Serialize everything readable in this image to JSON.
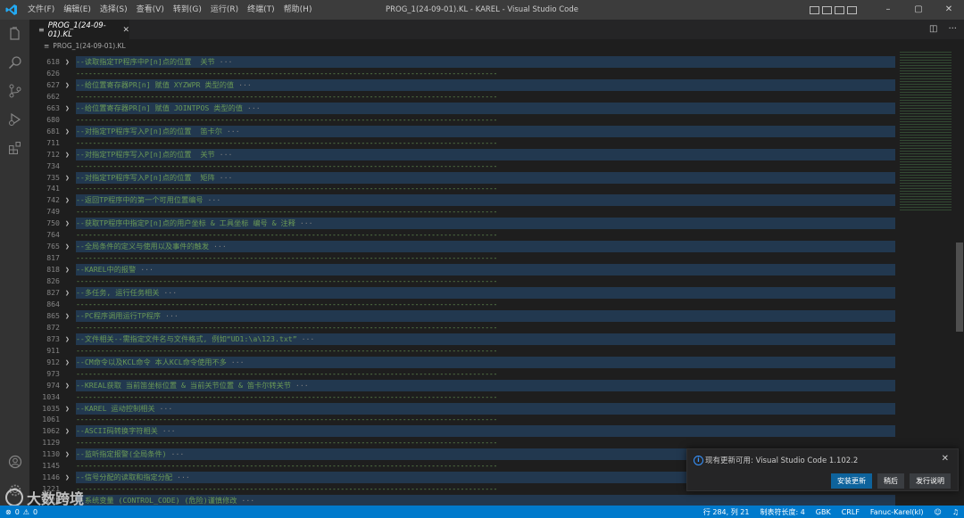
{
  "titlebar": {
    "menu": [
      "文件(F)",
      "编辑(E)",
      "选择(S)",
      "查看(V)",
      "转到(G)",
      "运行(R)",
      "终端(T)",
      "帮助(H)"
    ],
    "window_title": "PROG_1(24-09-01).KL - KAREL - Visual Studio Code"
  },
  "tab": {
    "label": "PROG_1(24-09-01).KL"
  },
  "breadcrumb": {
    "file": "PROG_1(24-09-01).KL"
  },
  "editor": {
    "lines": [
      {
        "num": "618",
        "text": "--读取指定TP程序中P[n]点的位置  关节",
        "fold": true
      },
      {
        "num": "626",
        "text": "------------------------------------------------------------------------------------------------------",
        "fold": false
      },
      {
        "num": "627",
        "text": "--给位置寄存器PR[n] 赋值 XYZWPR 类型的值",
        "fold": true
      },
      {
        "num": "662",
        "text": "------------------------------------------------------------------------------------------------------",
        "fold": false
      },
      {
        "num": "663",
        "text": "--给位置寄存器PR[n] 赋值 JOINTPOS 类型的值",
        "fold": true
      },
      {
        "num": "680",
        "text": "------------------------------------------------------------------------------------------------------",
        "fold": false
      },
      {
        "num": "681",
        "text": "--对指定TP程序写入P[n]点的位置  笛卡尔",
        "fold": true
      },
      {
        "num": "711",
        "text": "------------------------------------------------------------------------------------------------------",
        "fold": false
      },
      {
        "num": "712",
        "text": "--对指定TP程序写入P[n]点的位置  关节",
        "fold": true
      },
      {
        "num": "734",
        "text": "------------------------------------------------------------------------------------------------------",
        "fold": false
      },
      {
        "num": "735",
        "text": "--对指定TP程序写入P[n]点的位置  矩阵",
        "fold": true
      },
      {
        "num": "741",
        "text": "------------------------------------------------------------------------------------------------------",
        "fold": false
      },
      {
        "num": "742",
        "text": "--返回TP程序中的第一个可用位置编号",
        "fold": true
      },
      {
        "num": "749",
        "text": "------------------------------------------------------------------------------------------------------",
        "fold": false
      },
      {
        "num": "750",
        "text": "--获取TP程序中指定P[n]点的用户坐标 & 工具坐标 编号 & 注释",
        "fold": true
      },
      {
        "num": "764",
        "text": "------------------------------------------------------------------------------------------------------",
        "fold": false
      },
      {
        "num": "765",
        "text": "--全局条件的定义与使用以及事件的触发",
        "fold": true
      },
      {
        "num": "817",
        "text": "------------------------------------------------------------------------------------------------------",
        "fold": false
      },
      {
        "num": "818",
        "text": "--KAREL中的报警",
        "fold": true
      },
      {
        "num": "826",
        "text": "------------------------------------------------------------------------------------------------------",
        "fold": false
      },
      {
        "num": "827",
        "text": "--多任务, 运行任务相关",
        "fold": true
      },
      {
        "num": "864",
        "text": "------------------------------------------------------------------------------------------------------",
        "fold": false
      },
      {
        "num": "865",
        "text": "--PC程序调用运行TP程序",
        "fold": true
      },
      {
        "num": "872",
        "text": "------------------------------------------------------------------------------------------------------",
        "fold": false
      },
      {
        "num": "873",
        "text": "--文件相关--需指定文件名与文件格式, 例如“UD1:\\a\\123.txt”",
        "fold": true
      },
      {
        "num": "911",
        "text": "------------------------------------------------------------------------------------------------------",
        "fold": false
      },
      {
        "num": "912",
        "text": "--CM命令以及KCL命令 本人KCL命令使用不多",
        "fold": true
      },
      {
        "num": "973",
        "text": "------------------------------------------------------------------------------------------------------",
        "fold": false
      },
      {
        "num": "974",
        "text": "--KREAL获取 当前笛坐标位置 & 当前关节位置 & 笛卡尔转关节",
        "fold": true
      },
      {
        "num": "1034",
        "text": "------------------------------------------------------------------------------------------------------",
        "fold": false
      },
      {
        "num": "1035",
        "text": "--KAREL 运动控制相关",
        "fold": true
      },
      {
        "num": "1061",
        "text": "------------------------------------------------------------------------------------------------------",
        "fold": false
      },
      {
        "num": "1062",
        "text": "--ASCII码转换字符相关",
        "fold": true
      },
      {
        "num": "1129",
        "text": "------------------------------------------------------------------------------------------------------",
        "fold": false
      },
      {
        "num": "1130",
        "text": "--监听指定报警(全局条件)",
        "fold": true
      },
      {
        "num": "1145",
        "text": "------------------------------------------------------------------------------------------------------",
        "fold": false
      },
      {
        "num": "1146",
        "text": "--信号分配的读取和指定分配",
        "fold": true
      },
      {
        "num": "1221",
        "text": "------------------------------------------------------------------------------------------------------",
        "fold": false
      },
      {
        "num": "1222",
        "text": "--系统变量 (CONTROL_CODE) (危险)谨慎修改",
        "fold": true
      }
    ],
    "fold_suffix": "···"
  },
  "notification": {
    "message": "现有更新可用: Visual Studio Code 1.102.2",
    "buttons": [
      "安装更新",
      "稍后",
      "发行说明"
    ]
  },
  "statusbar": {
    "errors": "0",
    "warnings": "0",
    "position": "行 284, 列 21",
    "tab_size": "制表符长度: 4",
    "encoding": "GBK",
    "eol": "CRLF",
    "language": "Fanuc-Karel(kl)"
  },
  "watermark": {
    "text": "大数跨境"
  },
  "colors": {
    "accent": "#007acc",
    "comment": "#6a9955",
    "fold_highlight": "#264f78"
  }
}
